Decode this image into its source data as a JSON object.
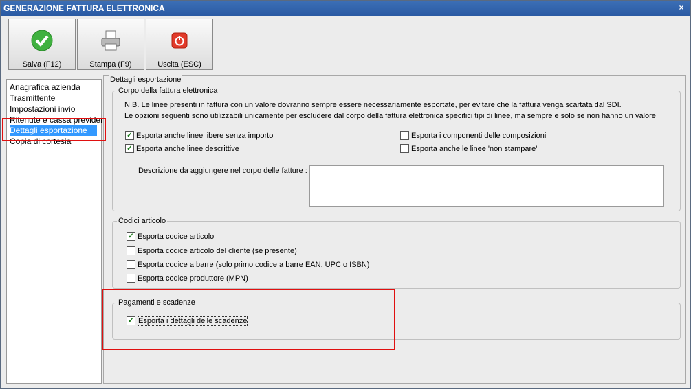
{
  "window": {
    "title": "GENERAZIONE FATTURA ELETTRONICA",
    "close": "×"
  },
  "toolbar": {
    "save_label": "Salva (F12)",
    "print_label": "Stampa (F9)",
    "exit_label": "Uscita (ESC)"
  },
  "nav": {
    "items": [
      {
        "label": "Anagrafica azienda"
      },
      {
        "label": "Trasmittente"
      },
      {
        "label": "Impostazioni invio"
      },
      {
        "label": "Ritenute e cassa previdenziale"
      },
      {
        "label": "Dettagli esportazione"
      },
      {
        "label": "Copia di cortesia"
      }
    ]
  },
  "panel": {
    "title": "Dettagli esportazione",
    "corpo": {
      "title": "Corpo della fattura elettronica",
      "note1": "N.B. Le linee presenti in fattura con un valore dovranno sempre essere necessariamente esportate, per evitare che la fattura venga scartata dal SDI.",
      "note2": "Le opzioni seguenti sono utilizzabili unicamente per escludere dal corpo della fattura elettronica specifici tipi di linee, ma sempre e solo se non hanno un valore",
      "checks": [
        {
          "label": "Esporta anche linee libere senza importo",
          "checked": true
        },
        {
          "label": "Esporta anche linee descrittive",
          "checked": true
        },
        {
          "label": "Esporta i componenti delle composizioni",
          "checked": false
        },
        {
          "label": "Esporta anche le linee 'non stampare'",
          "checked": false
        }
      ],
      "desc_label": "Descrizione da aggiungere nel corpo delle fatture :",
      "desc_value": ""
    },
    "codici": {
      "title": "Codici articolo",
      "checks": [
        {
          "label": "Esporta codice articolo",
          "checked": true
        },
        {
          "label": "Esporta codice articolo del cliente (se presente)",
          "checked": false
        },
        {
          "label": "Esporta codice a barre (solo primo codice a barre EAN, UPC o ISBN)",
          "checked": false
        },
        {
          "label": "Esporta codice produttore (MPN)",
          "checked": false
        }
      ]
    },
    "pagamenti": {
      "title": "Pagamenti e scadenze",
      "checks": [
        {
          "label": "Esporta i dettagli delle scadenze",
          "checked": true
        }
      ]
    }
  },
  "colors": {
    "titlebar": "#2a5aa3",
    "selection": "#3399ff",
    "highlight": "#e01010"
  }
}
